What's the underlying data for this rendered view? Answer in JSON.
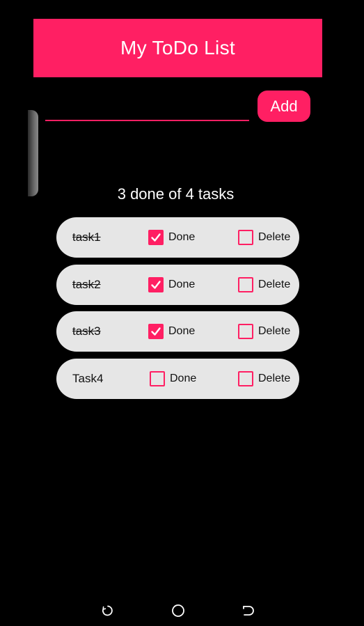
{
  "header": {
    "title": "My ToDo List"
  },
  "input": {
    "value": "",
    "placeholder": ""
  },
  "add_button": {
    "label": "Add"
  },
  "summary": "3 done of 4 tasks",
  "tasks": [
    {
      "name": "task1",
      "done": true,
      "done_label": "Done",
      "delete_label": "Delete",
      "delete_checked": false
    },
    {
      "name": "task2",
      "done": true,
      "done_label": "Done",
      "delete_label": "Delete",
      "delete_checked": false
    },
    {
      "name": "task3",
      "done": true,
      "done_label": "Done",
      "delete_label": "Delete",
      "delete_checked": false
    },
    {
      "name": "Task4",
      "done": false,
      "done_label": "Done",
      "delete_label": "Delete",
      "delete_checked": false
    }
  ],
  "nav": {
    "icons": [
      "recents-icon",
      "home-icon",
      "back-icon"
    ]
  },
  "colors": {
    "accent": "#ff1f63",
    "background": "#000000",
    "row_background": "#e6e6e6"
  }
}
